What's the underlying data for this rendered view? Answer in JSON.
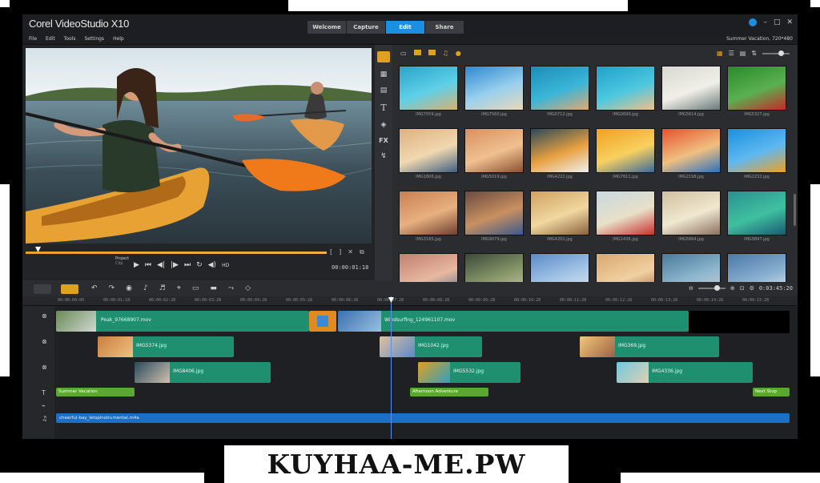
{
  "app": {
    "title": "Corel VideoStudio X10",
    "tabs": [
      {
        "label": "Welcome",
        "active": false
      },
      {
        "label": "Capture",
        "active": false
      },
      {
        "label": "Edit",
        "active": true
      },
      {
        "label": "Share",
        "active": false
      }
    ],
    "window_controls": [
      "?",
      "–",
      "□",
      "✕"
    ],
    "menu": [
      "File",
      "Edit",
      "Tools",
      "Settings",
      "Help"
    ],
    "project_info": "Summer Vacation, 720*480"
  },
  "player": {
    "scrub_progress": 1.0,
    "project_label": "Project",
    "clip_label": "Clip",
    "controls": [
      "play",
      "home",
      "prev-frame",
      "next-frame",
      "end",
      "repeat",
      "volume",
      "hd"
    ],
    "clip_tools": [
      "[",
      "]",
      "✕",
      "⧉"
    ],
    "timecode": "00:00:01:18"
  },
  "library": {
    "side_tabs": [
      "media",
      "instant-project",
      "transition",
      "title",
      "graphic",
      "fx",
      "path"
    ],
    "thumbnails": [
      {
        "caption": "IMG7559.jpg",
        "colors": [
          "#2aa4c8",
          "#5fd0e8",
          "#d8b070"
        ]
      },
      {
        "caption": "IMG7560.jpg",
        "colors": [
          "#2d88d0",
          "#9ad0ee",
          "#e8d8b8"
        ]
      },
      {
        "caption": "IMG0712.jpg",
        "colors": [
          "#1e8cb8",
          "#3ab6d8",
          "#e0a870"
        ]
      },
      {
        "caption": "IMG0699.jpg",
        "colors": [
          "#22a0c8",
          "#4cc8e0",
          "#f0c088"
        ]
      },
      {
        "caption": "IMG5614.jpg",
        "colors": [
          "#d8d8d0",
          "#f0efe8",
          "#6a7a7a"
        ]
      },
      {
        "caption": "IMG5327.jpg",
        "colors": [
          "#2a8a2a",
          "#5ab050",
          "#c82828"
        ]
      },
      {
        "caption": "IMG1806.jpg",
        "colors": [
          "#e0b080",
          "#f0d8b0",
          "#406080"
        ]
      },
      {
        "caption": "IMG5019.jpg",
        "colors": [
          "#d89060",
          "#f0c090",
          "#8a5030"
        ]
      },
      {
        "caption": "IMG4222.jpg",
        "colors": [
          "#2a4a5a",
          "#e8a040",
          "#f0f0f0"
        ]
      },
      {
        "caption": "IMG7611.jpg",
        "colors": [
          "#f0a020",
          "#f8d060",
          "#3a6a9a"
        ]
      },
      {
        "caption": "IMG2198.jpg",
        "colors": [
          "#e85030",
          "#f0c080",
          "#2a70c0"
        ]
      },
      {
        "caption": "IMG2232.jpg",
        "colors": [
          "#1890e0",
          "#60b8f0",
          "#f0a020"
        ]
      },
      {
        "caption": "IMG3165.jpg",
        "colors": [
          "#c88050",
          "#e8b080",
          "#6a4030"
        ]
      },
      {
        "caption": "IMG9079.jpg",
        "colors": [
          "#6a4a40",
          "#c89060",
          "#3a5a8a"
        ]
      },
      {
        "caption": "IMG4202.jpg",
        "colors": [
          "#d0a060",
          "#f0d8a0",
          "#8a6040"
        ]
      },
      {
        "caption": "IMG1436.jpg",
        "colors": [
          "#c8d8e0",
          "#e8e0c8",
          "#c83030"
        ]
      },
      {
        "caption": "IMG5664.jpg",
        "colors": [
          "#d0c0a0",
          "#f0e8d0",
          "#8a7060"
        ]
      },
      {
        "caption": "IMG9897.jpg",
        "colors": [
          "#2a9090",
          "#40c0a0",
          "#1a5a70"
        ]
      },
      {
        "caption": "",
        "colors": [
          "#c08070",
          "#e8b8a0",
          "#4a6a8a"
        ]
      },
      {
        "caption": "",
        "colors": [
          "#3a4a3a",
          "#8a9a6a",
          "#d0c8b0"
        ]
      },
      {
        "caption": "",
        "colors": [
          "#5a8ac8",
          "#a8c8e8",
          "#e0e8f0"
        ]
      },
      {
        "caption": "",
        "colors": [
          "#d8a870",
          "#f0d0a0",
          "#a06040"
        ]
      },
      {
        "caption": "",
        "colors": [
          "#4a7a9a",
          "#90b8d0",
          "#d0d0c8"
        ]
      },
      {
        "caption": "",
        "colors": [
          "#4a78a8",
          "#8ab0d0",
          "#e8eef2"
        ]
      }
    ]
  },
  "timeline": {
    "ruler_ticks": [
      "00:00:00:00",
      "00:00:01:18",
      "00:00:02:28",
      "00:00:03:28",
      "00:00:04:28",
      "00:00:05:28",
      "00:00:06:28",
      "00:00:07:28",
      "00:00:08:28",
      "00:00:09:28",
      "00:00:10:28",
      "00:00:11:28",
      "00:00:12:28",
      "00:00:13:28",
      "00:00:14:28",
      "00:00:15:28"
    ],
    "zoom_timecode": "0:03:45:20",
    "video_track": [
      {
        "name": "Peak_97668907.mov",
        "thumb": [
          "#6a8a5a",
          "#d0d8d0"
        ]
      },
      {
        "name": "Windsurfing_124961107.mov",
        "thumb": [
          "#3a70b0",
          "#9ac0e0"
        ]
      }
    ],
    "overlay1": [
      {
        "name": "IMG5374.jpg",
        "thumb": [
          "#c88040",
          "#f0c080"
        ]
      },
      {
        "name": "IMG1042.jpg",
        "thumb": [
          "#e0c0a0",
          "#5a8ac8"
        ]
      },
      {
        "name": "IMG369.jpg",
        "thumb": [
          "#f0c880",
          "#a06040"
        ]
      }
    ],
    "overlay2": [
      {
        "name": "IMG8406.jpg",
        "thumb": [
          "#2a4a5a",
          "#d0c0b0"
        ]
      },
      {
        "name": "IMG5532.jpg",
        "thumb": [
          "#e0a020",
          "#30a0c0"
        ]
      },
      {
        "name": "IMG4336.jpg",
        "thumb": [
          "#70c8e0",
          "#e0d0b0"
        ]
      }
    ],
    "titles": [
      "Summer Vacation",
      "Afternoon Adventure",
      "Next Stop"
    ],
    "audio": "cheerful-bay_letspinstrumental.m4a"
  },
  "watermark": "KUYHAA-ME.PW"
}
